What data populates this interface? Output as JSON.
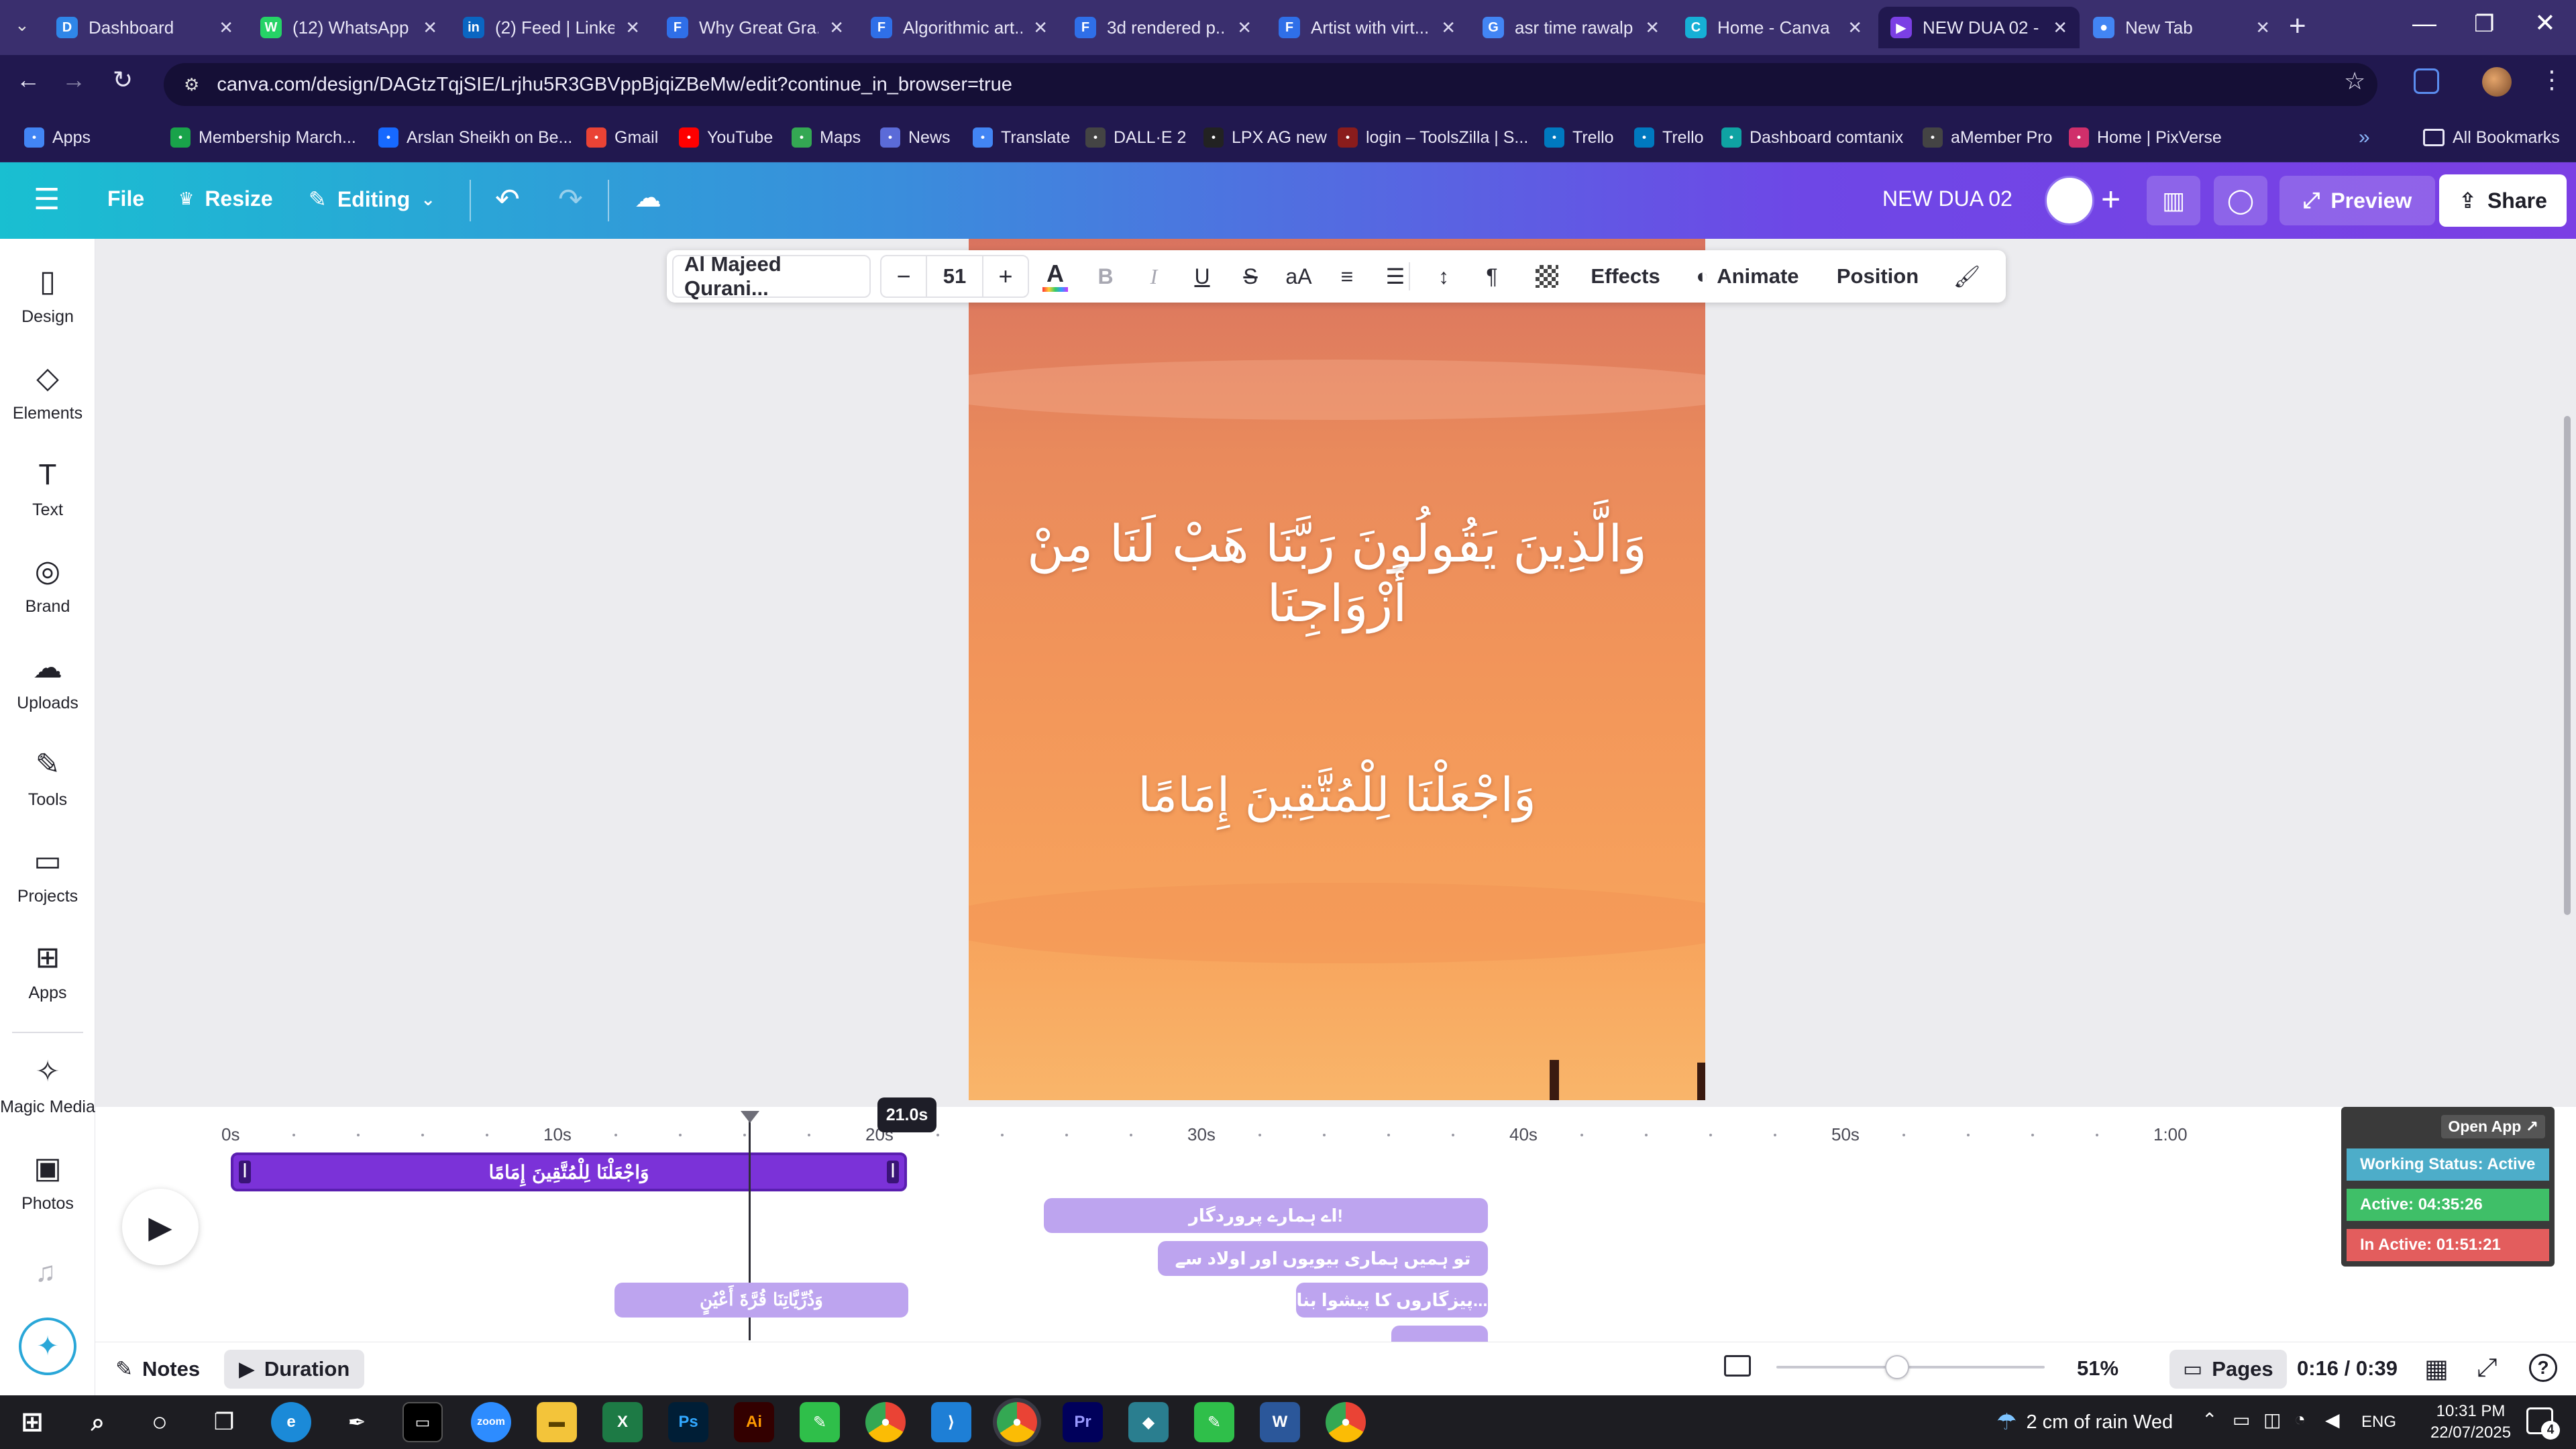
{
  "browser": {
    "tabs": [
      {
        "label": "Dashboard",
        "favicon": "D",
        "color": "#2f86e8"
      },
      {
        "label": "(12) WhatsApp",
        "favicon": "W",
        "color": "#25d366"
      },
      {
        "label": "(2) Feed | LinkedIn",
        "favicon": "in",
        "color": "#0a66c2"
      },
      {
        "label": "Why Great Gra...",
        "favicon": "F",
        "color": "#2f6fe8"
      },
      {
        "label": "Algorithmic art...",
        "favicon": "F",
        "color": "#2f6fe8"
      },
      {
        "label": "3d rendered p...",
        "favicon": "F",
        "color": "#2f6fe8"
      },
      {
        "label": "Artist with virt...",
        "favicon": "F",
        "color": "#2f6fe8"
      },
      {
        "label": "asr time rawalp...",
        "favicon": "G",
        "color": "#4285f4"
      },
      {
        "label": "Home - Canva",
        "favicon": "C",
        "color": "#16b0d6"
      },
      {
        "label": "NEW DUA 02 -",
        "favicon": "▶",
        "color": "#7b3fe4"
      },
      {
        "label": "New Tab",
        "favicon": "●",
        "color": "#4285f4"
      }
    ],
    "url": "canva.com/design/DAGtzTqjSIE/Lrjhu5R3GBVppBjqiZBeMw/edit?continue_in_browser=true",
    "bookmarks": [
      {
        "label": "Apps",
        "color": "#4285f4"
      },
      {
        "label": "Membership March...",
        "color": "#19a34a"
      },
      {
        "label": "Arslan Sheikh on Be...",
        "color": "#1769ff"
      },
      {
        "label": "Gmail",
        "color": "#ea4335"
      },
      {
        "label": "YouTube",
        "color": "#ff0000"
      },
      {
        "label": "Maps",
        "color": "#34a853"
      },
      {
        "label": "News",
        "color": "#5b6bd8"
      },
      {
        "label": "Translate",
        "color": "#4285f4"
      },
      {
        "label": "DALL·E 2",
        "color": "#444"
      },
      {
        "label": "LPX AG new",
        "color": "#222"
      },
      {
        "label": "login – ToolsZilla | S...",
        "color": "#8a1c1c"
      },
      {
        "label": "Trello",
        "color": "#0079bf"
      },
      {
        "label": "Trello",
        "color": "#0079bf"
      },
      {
        "label": "Dashboard comtanix",
        "color": "#0fa3a3"
      },
      {
        "label": "aMember Pro",
        "color": "#444"
      },
      {
        "label": "Home | PixVerse",
        "color": "#d02f6b"
      }
    ],
    "all_bookmarks": "All Bookmarks"
  },
  "canva_header": {
    "file": "File",
    "resize": "Resize",
    "editing": "Editing",
    "design_title": "NEW DUA 02",
    "preview": "Preview",
    "share": "Share"
  },
  "sidebar": {
    "items": [
      {
        "label": "Design",
        "icon": "design-icon"
      },
      {
        "label": "Elements",
        "icon": "elements-icon"
      },
      {
        "label": "Text",
        "icon": "text-icon"
      },
      {
        "label": "Brand",
        "icon": "brand-icon"
      },
      {
        "label": "Uploads",
        "icon": "uploads-icon"
      },
      {
        "label": "Tools",
        "icon": "tools-icon"
      },
      {
        "label": "Projects",
        "icon": "projects-icon"
      },
      {
        "label": "Apps",
        "icon": "apps-icon"
      },
      {
        "label": "Magic Media",
        "icon": "magic-media-icon"
      },
      {
        "label": "Photos",
        "icon": "photos-icon"
      }
    ]
  },
  "text_toolbar": {
    "font": "Al Majeed Qurani...",
    "size": "51",
    "effects": "Effects",
    "animate": "Animate",
    "position": "Position"
  },
  "canvas": {
    "line1": "وَالَّذِينَ يَقُولُونَ رَبَّنَا هَبْ لَنَا مِنْ أَزْوَاجِنَا",
    "line2": "وَاجْعَلْنَا لِلْمُتَّقِينَ إِمَامًا"
  },
  "timeline": {
    "ticks": [
      "0s",
      "10s",
      "20s",
      "30s",
      "40s",
      "50s",
      "1:00"
    ],
    "playhead_time": "21.0s",
    "selected_clip": "وَاجْعَلْنَا لِلْمُتَّقِينَ إِمَامًا",
    "clip_arabic": "وَذُرِّيَّاتِنَا قُرَّةَ أَعْيُنٍ",
    "clips_urdu": [
      "!اے ہمارے پروردگار",
      "تو ہمیں ہماری بیویوں اور اولاد سے",
      "...پیزگاروں کا پیشوا بنا"
    ]
  },
  "bottom_bar": {
    "notes": "Notes",
    "duration": "Duration",
    "zoom": "51%",
    "pages": "Pages",
    "time": "0:16 / 0:39",
    "zoom_level": 0.45
  },
  "widget": {
    "open_app": "Open App ↗",
    "status": "Working Status: Active",
    "active": "Active: 04:35:26",
    "inactive": "In Active: 01:51:21"
  },
  "taskbar": {
    "weather": "2 cm of rain Wed",
    "lang": "ENG",
    "time": "10:31 PM",
    "date": "22/07/2025",
    "notif": "4"
  }
}
